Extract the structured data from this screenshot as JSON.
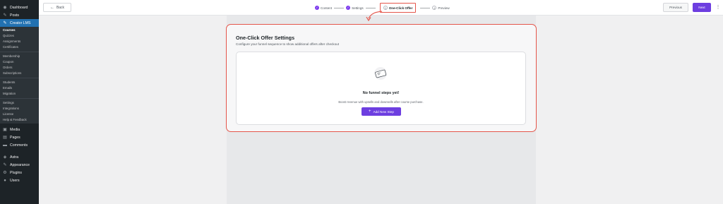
{
  "sidebar": {
    "top_items": [
      {
        "label": "Dashboard",
        "icon": "dashboard-icon",
        "glyph": "◉"
      },
      {
        "label": "Posts",
        "icon": "pin-icon",
        "glyph": "✎"
      },
      {
        "label": "Creator LMS",
        "icon": "lms-icon",
        "glyph": "✎"
      }
    ],
    "sub_items_1": [
      "Courses",
      "Quizzes",
      "Assignments",
      "Certificates"
    ],
    "sub_items_2": [
      "Membership",
      "Coupon",
      "Orders",
      "Subscriptions"
    ],
    "sub_items_3": [
      "Students",
      "Emails",
      "Migration"
    ],
    "sub_items_4": [
      "Settings",
      "Integrations",
      "License",
      "Help & Feedback"
    ],
    "bottom_items": [
      {
        "label": "Media",
        "icon": "media-icon",
        "glyph": "▣"
      },
      {
        "label": "Pages",
        "icon": "pages-icon",
        "glyph": "▤"
      },
      {
        "label": "Comments",
        "icon": "comments-icon",
        "glyph": "▬"
      },
      {
        "label": "Astra",
        "icon": "astra-icon",
        "glyph": "◈"
      },
      {
        "label": "Appearance",
        "icon": "appearance-icon",
        "glyph": "✎"
      },
      {
        "label": "Plugins",
        "icon": "plugins-icon",
        "glyph": "⚙"
      },
      {
        "label": "Users",
        "icon": "users-icon",
        "glyph": "●"
      }
    ]
  },
  "topbar": {
    "back_label": "Back",
    "steps": [
      {
        "label": "Content",
        "state": "done",
        "marker": "✓"
      },
      {
        "label": "Settings",
        "state": "done",
        "marker": "✓"
      },
      {
        "label": "One-Click Offer",
        "state": "current",
        "marker": "3"
      },
      {
        "label": "Preview",
        "state": "pending",
        "marker": "4"
      }
    ],
    "previous_label": "Previous",
    "next_label": "Next",
    "more_label": "⋮"
  },
  "card": {
    "title": "One-Click Offer Settings",
    "subtitle": "Configure your funnel sequence to show additional offers after checkout",
    "empty_title": "No funnel steps yet!",
    "empty_desc": "Boost revenue with upsells and downsells after course purchase.",
    "add_label": "Add New Step",
    "add_glyph": "+"
  },
  "colors": {
    "accent": "#6d3ee0",
    "highlight": "#e4554a",
    "sidebar_bg": "#1d2327",
    "sidebar_active": "#2271b1"
  }
}
